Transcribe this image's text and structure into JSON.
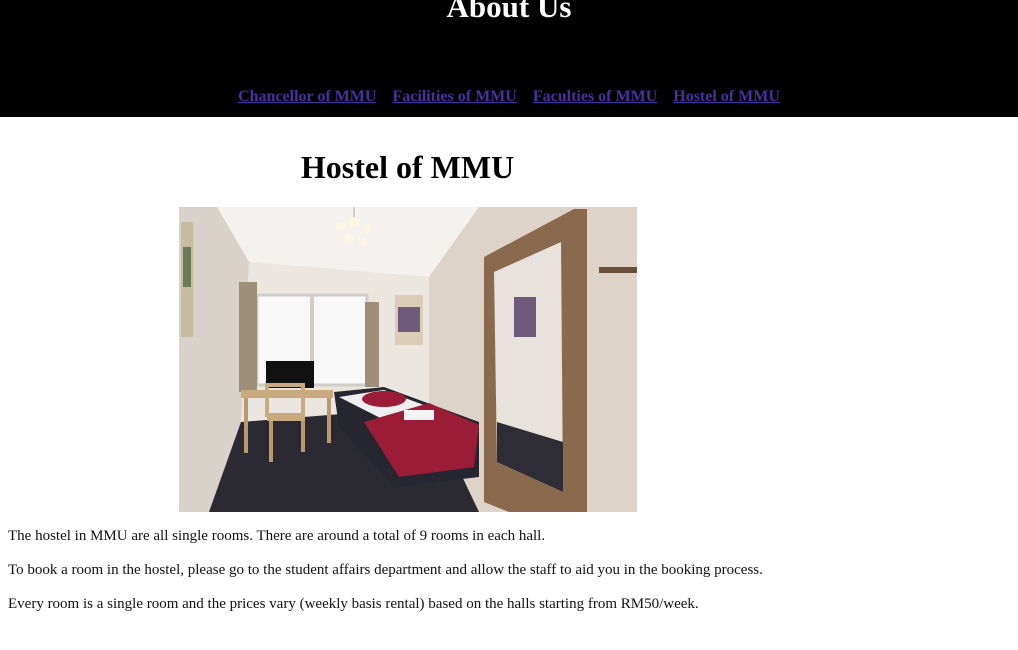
{
  "header": {
    "title": "About Us",
    "nav": [
      "Chancellor of MMU",
      "Facilities of MMU",
      "Faculties of MMU",
      "Hostel of MMU"
    ]
  },
  "main": {
    "heading": "Hostel of MMU",
    "paragraphs": [
      "The hostel in MMU are all single rooms. There are around a total of 9 rooms in each hall.",
      "To book a room in the hostel, please go to the student affairs department and allow the staff to aid you in the booking process.",
      "Every room is a single room and the prices vary (weekly basis rental) based on the halls starting from RM50/week."
    ]
  },
  "colors": {
    "header_bg": "#000000",
    "link": "#4b2fa0",
    "bedspread": "#9b1c36"
  }
}
